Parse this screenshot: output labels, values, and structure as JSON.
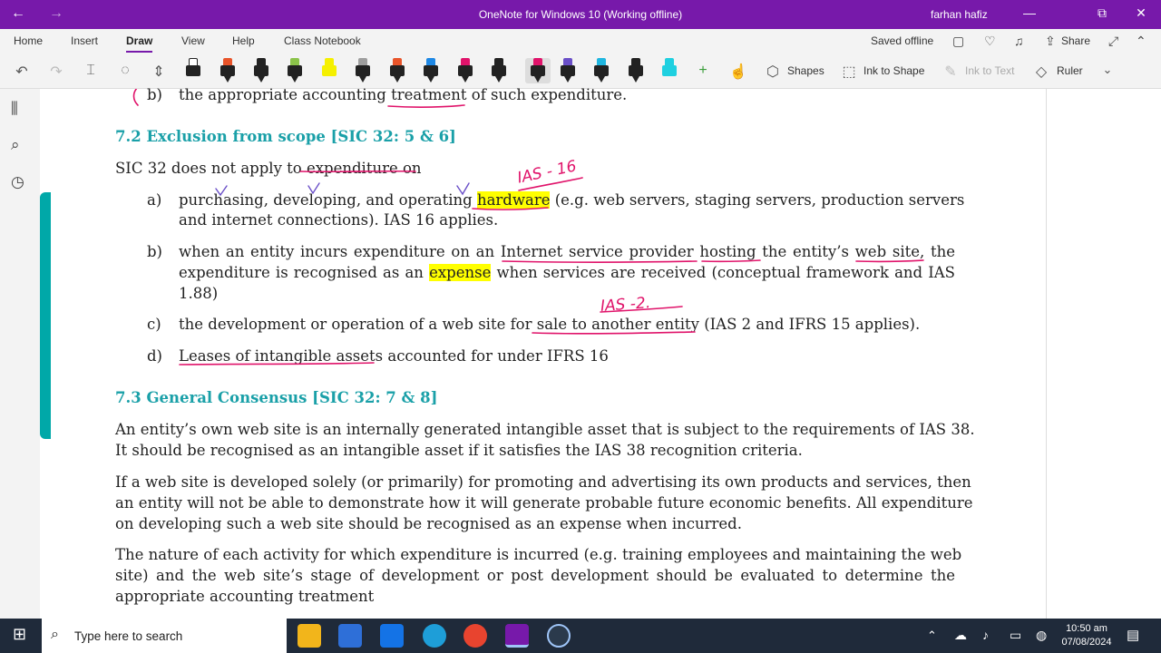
{
  "window": {
    "title": "OneNote for Windows 10 (Working offline)",
    "user": "farhan hafiz",
    "back": "←",
    "forward": "→",
    "minimize": "—",
    "maximize": "⧉",
    "close": "✕",
    "accent": "#7719aa"
  },
  "ribbon": {
    "tabs": [
      "Home",
      "Insert",
      "Draw",
      "View",
      "Help",
      "Class Notebook"
    ],
    "active_tab": "Draw",
    "status": "Saved offline",
    "share_label": "Share"
  },
  "toolbar": {
    "shapes_label": "Shapes",
    "ink_to_shape_label": "Ink to Shape",
    "ink_to_text_label": "Ink to Text",
    "ruler_label": "Ruler",
    "pens": [
      "#222222",
      "#e8542a",
      "#222222",
      "#8bc34a",
      "#f5f000",
      "#9e9e9e",
      "#e8542a",
      "#1e88e5",
      "#e0136a",
      "#222222",
      "#e0136a",
      "#6a4fc8",
      "#1fb6e0",
      "#222222",
      "#1fd0e0"
    ]
  },
  "document": {
    "line_b_top_label": "b)",
    "line_b_top": [
      "the appropriate accounting ",
      "treatment",
      " of such expenditure."
    ],
    "h72": "7.2 Exclusion from scope [SIC 32: 5 & 6]",
    "p_sic32": "SIC 32 does not apply to expenditure on",
    "item_a_label": "a)",
    "item_a_1": [
      "purchasing, developing, and operating ",
      "hardware",
      " (e.g. web servers, staging servers, production servers"
    ],
    "item_a_2": "and internet connections). IAS 16 applies.",
    "item_b_label": "b)",
    "item_b_1": "when an entity incurs expenditure on an Internet service provider hosting the entity’s web site, the",
    "item_b_2": [
      "expenditure is recognised as an ",
      "expense",
      " when services are received (conceptual framework and IAS"
    ],
    "item_b_3": "1.88)",
    "item_c_label": "c)",
    "item_c": "the development or operation of a web site for sale to another entity (IAS 2 and IFRS 15 applies).",
    "item_d_label": "d)",
    "item_d": "Leases of intangible assets accounted for under IFRS 16",
    "h73": "7.3 General Consensus [SIC 32: 7 & 8]",
    "p1_1": "An entity’s own web site is an internally generated intangible asset that is subject to the requirements of IAS 38.",
    "p1_2": "It should be recognised as an intangible asset if it satisfies the IAS 38 recognition criteria.",
    "p2_1": "If a web site is developed solely (or primarily) for promoting and advertising its own products and services, then",
    "p2_2": "an entity will not be able to demonstrate how it will generate probable future economic benefits. All expenditure",
    "p2_3": "on developing such a web site should be recognised as an expense when incurred.",
    "p3_1": "The nature of each activity for which expenditure is incurred (e.g. training employees and maintaining the web",
    "p3_2": "site) and the web site’s stage of development or post development should be evaluated to determine the",
    "p3_3": "appropriate accounting treatment",
    "ink_ias16": "IAS - 16",
    "ink_ias2": "IAS -2.",
    "heading_color": "#1aa0a8",
    "ink_color": "#e0136a",
    "highlight_color": "#ffff00"
  },
  "taskbar": {
    "search_placeholder": "Type here to search",
    "time": "10:50 am",
    "date": "07/08/2024"
  }
}
